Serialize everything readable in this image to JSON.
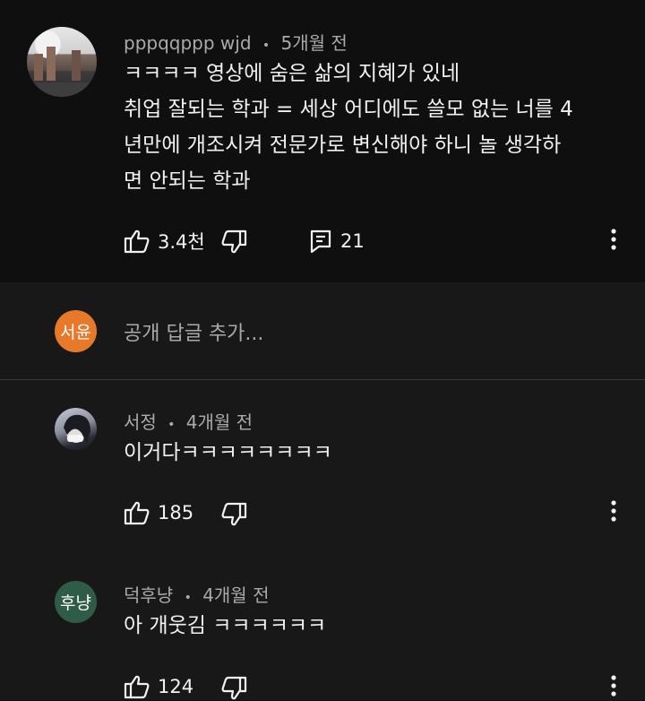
{
  "main_comment": {
    "author": "pppqqppp wjd",
    "time": "5개월 전",
    "lines": [
      "ㅋㅋㅋㅋ 영상에 숨은 삶의 지혜가 있네",
      "취업 잘되는 학과 = 세상 어디에도 쓸모 없는 너를 4",
      "년만에 개조시켜 전문가로 변신해야 하니 놀 생각하",
      "면 안되는 학과"
    ],
    "likes": "3.4천",
    "replies_count": "21"
  },
  "reply_box": {
    "avatar_text": "서윤",
    "avatar_color": "#e8792b",
    "placeholder": "공개 답글 추가..."
  },
  "replies": [
    {
      "author": "서정",
      "time": "4개월 전",
      "text": "이거다ㅋㅋㅋㅋㅋㅋㅋㅋ",
      "likes": "185"
    },
    {
      "author": "덕후냥",
      "time": "4개월 전",
      "text": "아 개웃김 ㅋㅋㅋㅋㅋㅋ",
      "likes": "124",
      "avatar_text": "후냥",
      "avatar_color": "#2f5c46"
    }
  ],
  "separator": "•",
  "icons": {
    "like": "thumb-up-icon",
    "dislike": "thumb-down-icon",
    "reply": "comment-icon",
    "menu": "more-vert-icon"
  }
}
